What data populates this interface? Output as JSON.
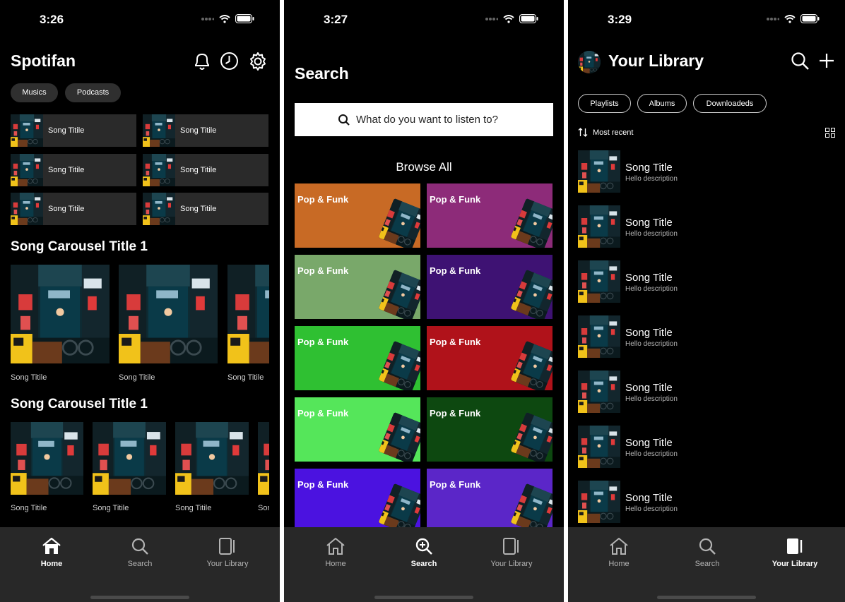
{
  "screen1": {
    "time": "3:26",
    "app_title": "Spotifan",
    "chips": [
      "Musics",
      "Podcasts"
    ],
    "grid_items": [
      "Song Titile",
      "Song Titile",
      "Song Titile",
      "Song Titile",
      "Song Titile",
      "Song Titile"
    ],
    "carousel1": {
      "title": "Song Carousel Title 1",
      "items": [
        "Song Titile",
        "Song Titile",
        "Song Titile"
      ]
    },
    "carousel2": {
      "title": "Song Carousel Title 1",
      "items": [
        "Song Titile",
        "Song Titile",
        "Song Titile",
        "Song Titile"
      ]
    }
  },
  "screen2": {
    "time": "3:27",
    "title": "Search",
    "search_placeholder": "What do you want to listen to?",
    "browse_title": "Browse All",
    "categories": [
      {
        "label": "Pop & Funk",
        "color": "#c86a25"
      },
      {
        "label": "Pop & Funk",
        "color": "#8d2b79"
      },
      {
        "label": "Pop & Funk",
        "color": "#79a86a"
      },
      {
        "label": "Pop & Funk",
        "color": "#3e1273"
      },
      {
        "label": "Pop & Funk",
        "color": "#2fc032"
      },
      {
        "label": "Pop & Funk",
        "color": "#b0121a"
      },
      {
        "label": "Pop & Funk",
        "color": "#55e65a"
      },
      {
        "label": "Pop & Funk",
        "color": "#0d4810"
      },
      {
        "label": "Pop & Funk",
        "color": "#4b12e0"
      },
      {
        "label": "Pop & Funk",
        "color": "#5b26c8"
      }
    ]
  },
  "screen3": {
    "time": "3:29",
    "title": "Your Library",
    "filters": [
      "Playlists",
      "Albums",
      "Downloadeds"
    ],
    "sort_label": "Most recent",
    "items": [
      {
        "title": "Song Title",
        "desc": "Hello description"
      },
      {
        "title": "Song Title",
        "desc": "Hello description"
      },
      {
        "title": "Song Title",
        "desc": "Hello description"
      },
      {
        "title": "Song Title",
        "desc": "Hello description"
      },
      {
        "title": "Song Title",
        "desc": "Hello description"
      },
      {
        "title": "Song Title",
        "desc": "Hello description"
      },
      {
        "title": "Song Title",
        "desc": "Hello description"
      }
    ]
  },
  "tabbar": {
    "home": "Home",
    "search": "Search",
    "library": "Your Library"
  },
  "colors": {
    "background": "#000000",
    "tabbar": "#282828",
    "tile": "#2a2a2a",
    "chip": "#2f2f2f"
  }
}
